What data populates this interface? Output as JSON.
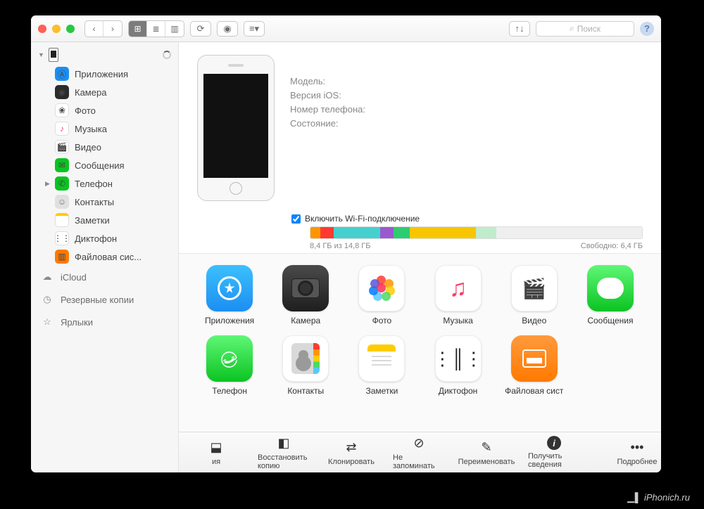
{
  "titlebar": {
    "search_placeholder": "Поиск"
  },
  "sidebar": {
    "items": [
      {
        "id": "apps",
        "label": "Приложения"
      },
      {
        "id": "camera",
        "label": "Камера"
      },
      {
        "id": "photos",
        "label": "Фото"
      },
      {
        "id": "music",
        "label": "Музыка"
      },
      {
        "id": "video",
        "label": "Видео"
      },
      {
        "id": "messages",
        "label": "Сообщения"
      },
      {
        "id": "phone",
        "label": "Телефон"
      },
      {
        "id": "contacts",
        "label": "Контакты"
      },
      {
        "id": "notes",
        "label": "Заметки"
      },
      {
        "id": "voice",
        "label": "Диктофон"
      },
      {
        "id": "files",
        "label": "Файловая сис..."
      }
    ],
    "sections": {
      "icloud": "iCloud",
      "backups": "Резервные копии",
      "shortcuts": "Ярлыки"
    }
  },
  "details": {
    "model_label": "Модель:",
    "ios_label": "Версия iOS:",
    "phone_label": "Номер телефона:",
    "state_label": "Состояние:"
  },
  "wifi_label": "Включить Wi-Fi-подключение",
  "storage": {
    "segments": [
      {
        "color": "#ff9500",
        "pct": 3
      },
      {
        "color": "#ff3b30",
        "pct": 4
      },
      {
        "color": "#45d0cf",
        "pct": 14
      },
      {
        "color": "#9b59d0",
        "pct": 4
      },
      {
        "color": "#2ecc71",
        "pct": 5
      },
      {
        "color": "#f7c600",
        "pct": 20
      },
      {
        "color": "#bfeccb",
        "pct": 6
      },
      {
        "color": "#efefef",
        "pct": 44
      }
    ],
    "used_label": "8,4 ГБ из 14,8 ГБ",
    "free_label": "Свободно: 6,4 ГБ"
  },
  "apps": [
    {
      "id": "apps",
      "label": "Приложения"
    },
    {
      "id": "camera",
      "label": "Камера"
    },
    {
      "id": "photos",
      "label": "Фото"
    },
    {
      "id": "music",
      "label": "Музыка"
    },
    {
      "id": "video",
      "label": "Видео"
    },
    {
      "id": "messages",
      "label": "Сообщения"
    },
    {
      "id": "phone",
      "label": "Телефон"
    },
    {
      "id": "contacts",
      "label": "Контакты"
    },
    {
      "id": "notes",
      "label": "Заметки"
    },
    {
      "id": "voice",
      "label": "Диктофон"
    },
    {
      "id": "files",
      "label": "Файловая сист"
    }
  ],
  "toolbar": {
    "t0": "ия",
    "t1": "Восстановить копию",
    "t2": "Клонировать",
    "t3": "Не запоминать",
    "t4": "Переименовать",
    "t5": "Получить сведения",
    "t6": "Подробнее"
  },
  "watermark": "iPhonich.ru"
}
